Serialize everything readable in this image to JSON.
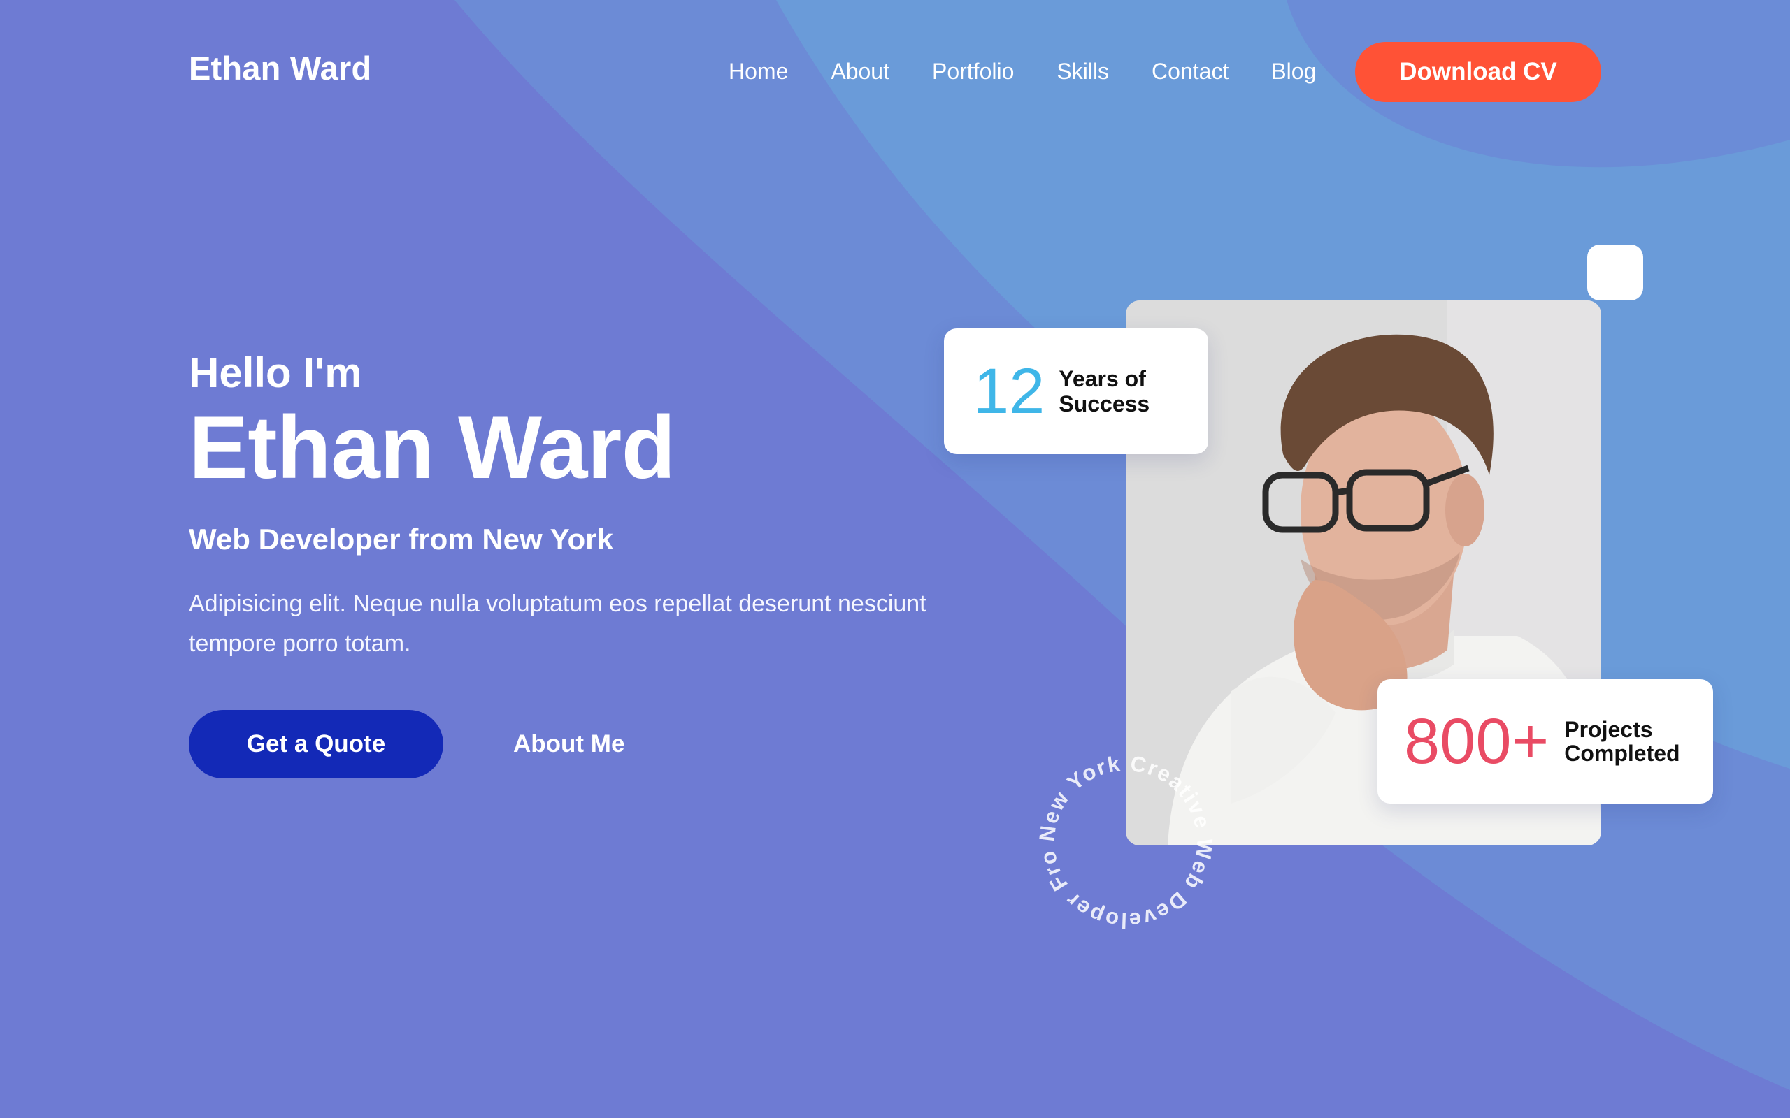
{
  "colors": {
    "background": "#6e7bd3",
    "accent_cv": "#ff5236",
    "accent_quote": "#1329b7",
    "stat_years": "#3fb6e8",
    "stat_projects": "#e94b64"
  },
  "header": {
    "logo": "Ethan Ward",
    "nav": [
      "Home",
      "About",
      "Portfolio",
      "Skills",
      "Contact",
      "Blog"
    ],
    "cta": "Download CV"
  },
  "hero": {
    "greeting": "Hello I'm",
    "name": "Ethan Ward",
    "role": "Web Developer from New York",
    "description": "Adipisicing elit. Neque nulla voluptatum eos repellat deserunt nesciunt tempore porro totam.",
    "primary_button": "Get a Quote",
    "secondary_link": "About Me"
  },
  "stats": {
    "years": {
      "number": "12",
      "label_line1": "Years of",
      "label_line2": "Success"
    },
    "projects": {
      "number": "800+",
      "label_line1": "Projects",
      "label_line2": "Completed"
    }
  },
  "circle_text": "New York Creative Web Developer From",
  "icons": {
    "photo": "portrait-photo",
    "decor": "white-square-decoration"
  }
}
